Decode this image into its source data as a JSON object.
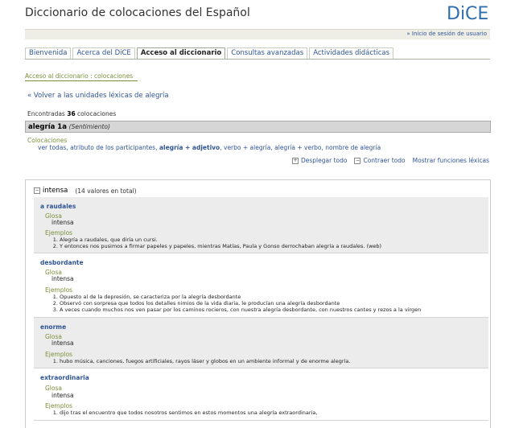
{
  "header": {
    "site_title": "Diccionario de colocaciones del Español",
    "logo_text": "DiCE",
    "login_link": "» Inicio de sesión de usuario"
  },
  "tabs": [
    {
      "label": "Bienvenida",
      "active": false
    },
    {
      "label": "Acerca del DiCE",
      "active": false
    },
    {
      "label": "Acceso al diccionario",
      "active": true
    },
    {
      "label": "Consultas avanzadas",
      "active": false
    },
    {
      "label": "Actividades didácticas",
      "active": false
    }
  ],
  "breadcrumb": {
    "root": "Acceso al diccionario",
    "separator": " : ",
    "current": "colocaciones"
  },
  "back_link": "« Volver a las unidades léxicas de alegría",
  "found": {
    "prefix": "Encontradas ",
    "count": "36",
    "suffix": " colocaciones"
  },
  "lexical_unit": {
    "lemma": "alegría 1a",
    "semantic": "(Sentimiento)"
  },
  "collocations": {
    "heading": "Colocaciones",
    "links": [
      {
        "text": "ver todas",
        "current": false
      },
      {
        "text": "atributo de los participantes",
        "current": false
      },
      {
        "text": "alegría + adjetivo",
        "current": true
      },
      {
        "text": "verbo + alegría",
        "current": false
      },
      {
        "text": "alegría + verbo",
        "current": false
      },
      {
        "text": "nombre de alegría",
        "current": false
      }
    ],
    "separator": ", "
  },
  "actions": {
    "expand": "Desplegar todo",
    "collapse": "Contraer todo",
    "show_functions": "Mostrar funciones léxicas"
  },
  "panel": {
    "group": "intensa",
    "group_count": "(14 valores en total)",
    "glosa_label": "Glosa",
    "examples_label": "Ejemplos",
    "entries": [
      {
        "headword": "a raudales",
        "glosa": "intensa",
        "examples": [
          "Alegría a raudales, que diría un cursi.",
          "Y entonces nos pusimos a firmar papeles y papeles, mientras Matías, Paula y Gonso derrochaban alegría a raudales. (web)"
        ]
      },
      {
        "headword": "desbordante",
        "glosa": "intensa",
        "examples": [
          "Opuesto al de la depresión, se caracteriza por la alegría desbordante",
          "Observó con sorpresa que todos los detalles nimios de la vida diaria, le producían una alegría desbordante",
          "A veces cuando muchos nos ven pasar por los caminos rocieros, con nuestra alegría desbordante, con nuestros cantes y rezos a la virgen"
        ]
      },
      {
        "headword": "enorme",
        "glosa": "intensa",
        "examples": [
          "hubo música, canciones, fuegos artificiales, rayos láser y globos en un ambiente informal y de enorme alegría."
        ]
      },
      {
        "headword": "extraordinaria",
        "glosa": "intensa",
        "examples": [
          "dijo tras el encuentro que todos nosotros sentimos en estos momentos una alegría extraordinaria,"
        ]
      }
    ]
  }
}
